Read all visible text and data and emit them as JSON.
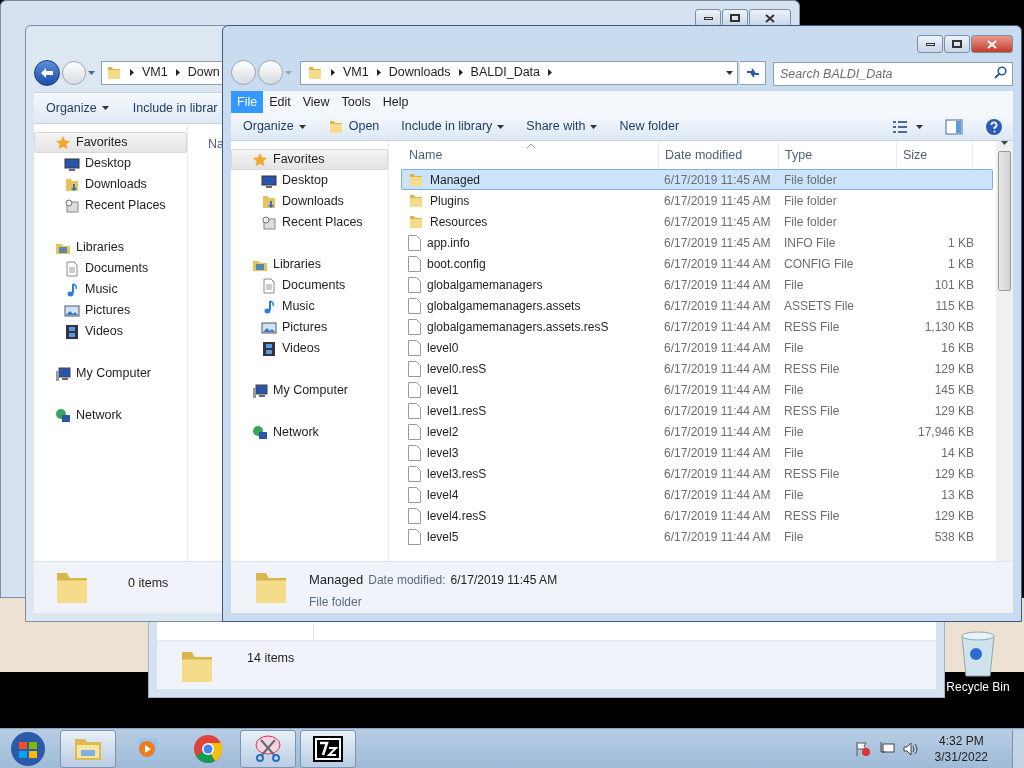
{
  "back_window": {
    "status_text": "14 items"
  },
  "middle_window": {
    "breadcrumb": [
      "VM1",
      "Down"
    ],
    "toolbar": [
      {
        "label": "Organize",
        "kind": "dropdown"
      },
      {
        "label": "Include in librar",
        "kind": "command"
      }
    ],
    "nav": [
      {
        "label": "Favorites",
        "highlighted": true,
        "children": [
          {
            "label": "Desktop"
          },
          {
            "label": "Downloads"
          },
          {
            "label": "Recent Places"
          }
        ]
      },
      {
        "label": "Libraries",
        "highlighted": false,
        "children": [
          {
            "label": "Documents"
          },
          {
            "label": "Music"
          },
          {
            "label": "Pictures"
          },
          {
            "label": "Videos"
          }
        ]
      },
      {
        "label": "My Computer",
        "highlighted": false
      },
      {
        "label": "Network",
        "highlighted": false
      }
    ],
    "column_header": "Na",
    "status_text": "0 items"
  },
  "front_window": {
    "breadcrumb": [
      "VM1",
      "Downloads",
      "BALDI_Data"
    ],
    "search_placeholder": "Search BALDI_Data",
    "menu": [
      {
        "label": "File",
        "selected": true
      },
      {
        "label": "Edit",
        "selected": false
      },
      {
        "label": "View",
        "selected": false
      },
      {
        "label": "Tools",
        "selected": false
      },
      {
        "label": "Help",
        "selected": false
      }
    ],
    "toolbar": [
      {
        "label": "Organize",
        "kind": "dropdown"
      },
      {
        "label": "Open",
        "kind": "icon-command"
      },
      {
        "label": "Include in library",
        "kind": "dropdown"
      },
      {
        "label": "Share with",
        "kind": "dropdown"
      },
      {
        "label": "New folder",
        "kind": "command"
      }
    ],
    "nav": [
      {
        "label": "Favorites",
        "highlighted": true,
        "children": [
          {
            "label": "Desktop"
          },
          {
            "label": "Downloads"
          },
          {
            "label": "Recent Places"
          }
        ]
      },
      {
        "label": "Libraries",
        "highlighted": false,
        "children": [
          {
            "label": "Documents"
          },
          {
            "label": "Music"
          },
          {
            "label": "Pictures"
          },
          {
            "label": "Videos"
          }
        ]
      },
      {
        "label": "My Computer",
        "highlighted": false
      },
      {
        "label": "Network",
        "highlighted": false
      }
    ],
    "columns": [
      "Name",
      "Date modified",
      "Type",
      "Size"
    ],
    "rows": [
      {
        "kind": "folder",
        "name": "Managed",
        "date": "6/17/2019 11:45 AM",
        "type": "File folder",
        "selected": true
      },
      {
        "kind": "folder",
        "name": "Plugins",
        "date": "6/17/2019 11:45 AM",
        "type": "File folder",
        "selected": false
      },
      {
        "kind": "folder",
        "name": "Resources",
        "date": "6/17/2019 11:45 AM",
        "type": "File folder",
        "selected": false
      },
      {
        "kind": "file",
        "name": "app.info",
        "date": "6/17/2019 11:45 AM",
        "type": "INFO File",
        "size": "1 KB",
        "selected": false
      },
      {
        "kind": "file",
        "name": "boot.config",
        "date": "6/17/2019 11:44 AM",
        "type": "CONFIG File",
        "size": "1 KB",
        "selected": false
      },
      {
        "kind": "file",
        "name": "globalgamemanagers",
        "date": "6/17/2019 11:44 AM",
        "type": "File",
        "size": "101 KB",
        "selected": false
      },
      {
        "kind": "file",
        "name": "globalgamemanagers.assets",
        "date": "6/17/2019 11:44 AM",
        "type": "ASSETS File",
        "size": "115 KB",
        "selected": false
      },
      {
        "kind": "file",
        "name": "globalgamemanagers.assets.resS",
        "date": "6/17/2019 11:44 AM",
        "type": "RESS File",
        "size": "1,130 KB",
        "selected": false
      },
      {
        "kind": "file",
        "name": "level0",
        "date": "6/17/2019 11:44 AM",
        "type": "File",
        "size": "16 KB",
        "selected": false
      },
      {
        "kind": "file",
        "name": "level0.resS",
        "date": "6/17/2019 11:44 AM",
        "type": "RESS File",
        "size": "129 KB",
        "selected": false
      },
      {
        "kind": "file",
        "name": "level1",
        "date": "6/17/2019 11:44 AM",
        "type": "File",
        "size": "145 KB",
        "selected": false
      },
      {
        "kind": "file",
        "name": "level1.resS",
        "date": "6/17/2019 11:44 AM",
        "type": "RESS File",
        "size": "129 KB",
        "selected": false
      },
      {
        "kind": "file",
        "name": "level2",
        "date": "6/17/2019 11:44 AM",
        "type": "File",
        "size": "17,946 KB",
        "selected": false
      },
      {
        "kind": "file",
        "name": "level3",
        "date": "6/17/2019 11:44 AM",
        "type": "File",
        "size": "14 KB",
        "selected": false
      },
      {
        "kind": "file",
        "name": "level3.resS",
        "date": "6/17/2019 11:44 AM",
        "type": "RESS File",
        "size": "129 KB",
        "selected": false
      },
      {
        "kind": "file",
        "name": "level4",
        "date": "6/17/2019 11:44 AM",
        "type": "File",
        "size": "13 KB",
        "selected": false
      },
      {
        "kind": "file",
        "name": "level4.resS",
        "date": "6/17/2019 11:44 AM",
        "type": "RESS File",
        "size": "129 KB",
        "selected": false
      },
      {
        "kind": "file",
        "name": "level5",
        "date": "6/17/2019 11:44 AM",
        "type": "File",
        "size": "538 KB",
        "selected": false
      }
    ],
    "details": {
      "name": "Managed",
      "date_label": "Date modified:",
      "date": "6/17/2019 11:45 AM",
      "type": "File folder"
    }
  },
  "desktop_icons": [
    {
      "label": "Recycle Bin"
    }
  ],
  "taskbar": {
    "buttons": [
      {
        "running": true
      },
      {
        "running": false
      },
      {
        "running": false
      },
      {
        "running": true
      },
      {
        "running": true
      }
    ],
    "clock": {
      "time": "4:32 PM",
      "date": "3/31/2022"
    }
  }
}
